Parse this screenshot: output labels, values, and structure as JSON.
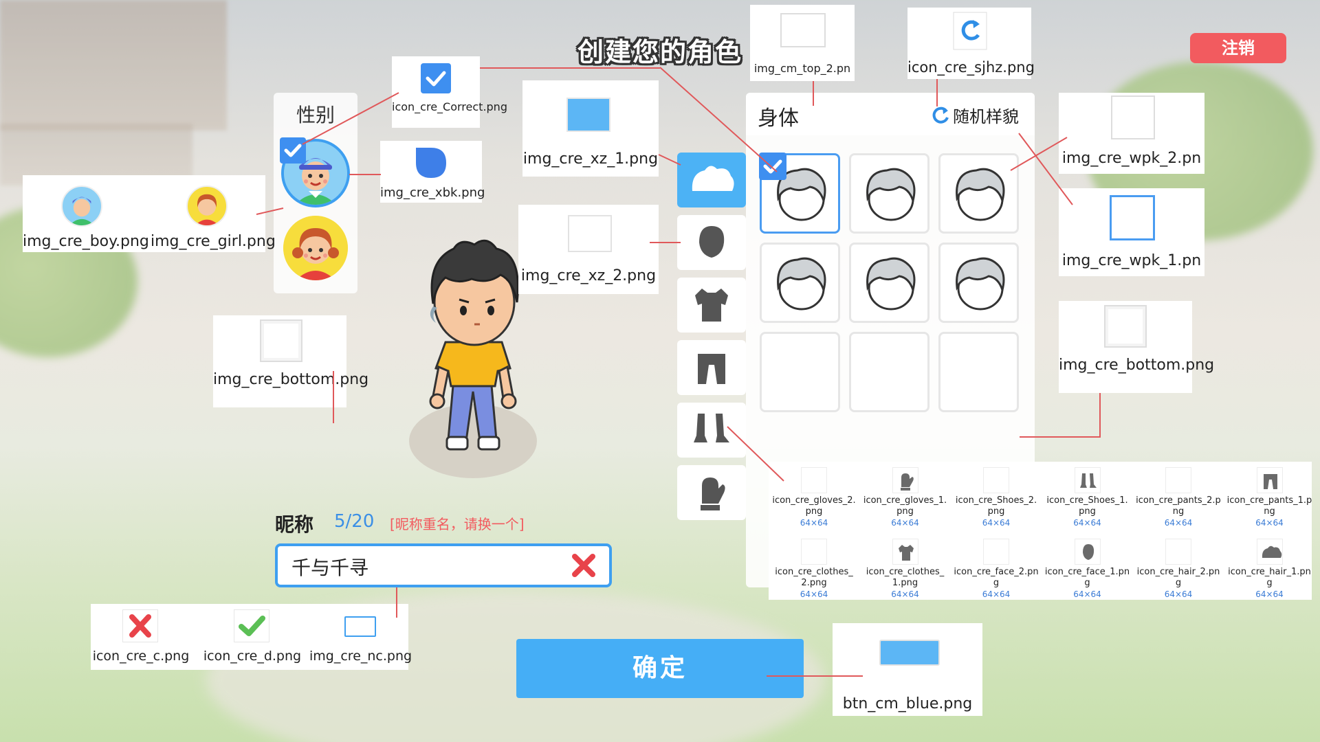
{
  "title": "创建您的角色",
  "logout_label": "注销",
  "gender": {
    "title": "性别"
  },
  "body_panel": {
    "title": "身体",
    "random_label": "随机样貌"
  },
  "nickname": {
    "label": "昵称",
    "count": "5/20",
    "warning": "[昵称重名，请换一个]",
    "value": "千与千寻"
  },
  "confirm_label": "确定",
  "annotations": {
    "correct": "icon_cre_Correct.png",
    "xbk": "img_cre_xbk.png",
    "boy": "img_cre_boy.png",
    "girl": "img_cre_girl.png",
    "bottom_left": "img_cre_bottom.png",
    "xz1": "img_cre_xz_1.png",
    "xz2": "img_cre_xz_2.png",
    "top2": "img_cm_top_2.pn",
    "sjhz": "icon_cre_sjhz.png",
    "wpk2": "img_cre_wpk_2.pn",
    "wpk1": "img_cre_wpk_1.pn",
    "bottom_right": "img_cre_bottom.png",
    "c": "icon_cre_c.png",
    "d": "icon_cre_d.png",
    "nc": "img_cre_nc.png",
    "btn_blue": "btn_cm_blue.png"
  },
  "icon_list": [
    {
      "name": "icon_cre_gloves_2.png",
      "size": "64×64",
      "icon": "gloves-outline-icon"
    },
    {
      "name": "icon_cre_gloves_1.png",
      "size": "64×64",
      "icon": "gloves-icon"
    },
    {
      "name": "icon_cre_Shoes_2.png",
      "size": "64×64",
      "icon": "shoes-outline-icon"
    },
    {
      "name": "icon_cre_Shoes_1.png",
      "size": "64×64",
      "icon": "shoes-icon"
    },
    {
      "name": "icon_cre_pants_2.png",
      "size": "64×64",
      "icon": "pants-outline-icon"
    },
    {
      "name": "icon_cre_pants_1.png",
      "size": "64×64",
      "icon": "pants-icon"
    },
    {
      "name": "icon_cre_clothes_2.png",
      "size": "64×64",
      "icon": "clothes-outline-icon"
    },
    {
      "name": "icon_cre_clothes_1.png",
      "size": "64×64",
      "icon": "clothes-icon"
    },
    {
      "name": "icon_cre_face_2.png",
      "size": "64×64",
      "icon": "face-outline-icon"
    },
    {
      "name": "icon_cre_face_1.png",
      "size": "64×64",
      "icon": "face-icon"
    },
    {
      "name": "icon_cre_hair_2.png",
      "size": "64×64",
      "icon": "hair-outline-icon"
    },
    {
      "name": "icon_cre_hair_1.png",
      "size": "64×64",
      "icon": "hair-icon"
    }
  ],
  "categories": [
    "hair",
    "face",
    "clothes",
    "pants",
    "shoes",
    "gloves"
  ],
  "colors": {
    "accent_blue": "#45aef6",
    "danger_red": "#f25b5f",
    "annotation_line": "#e0585a"
  }
}
